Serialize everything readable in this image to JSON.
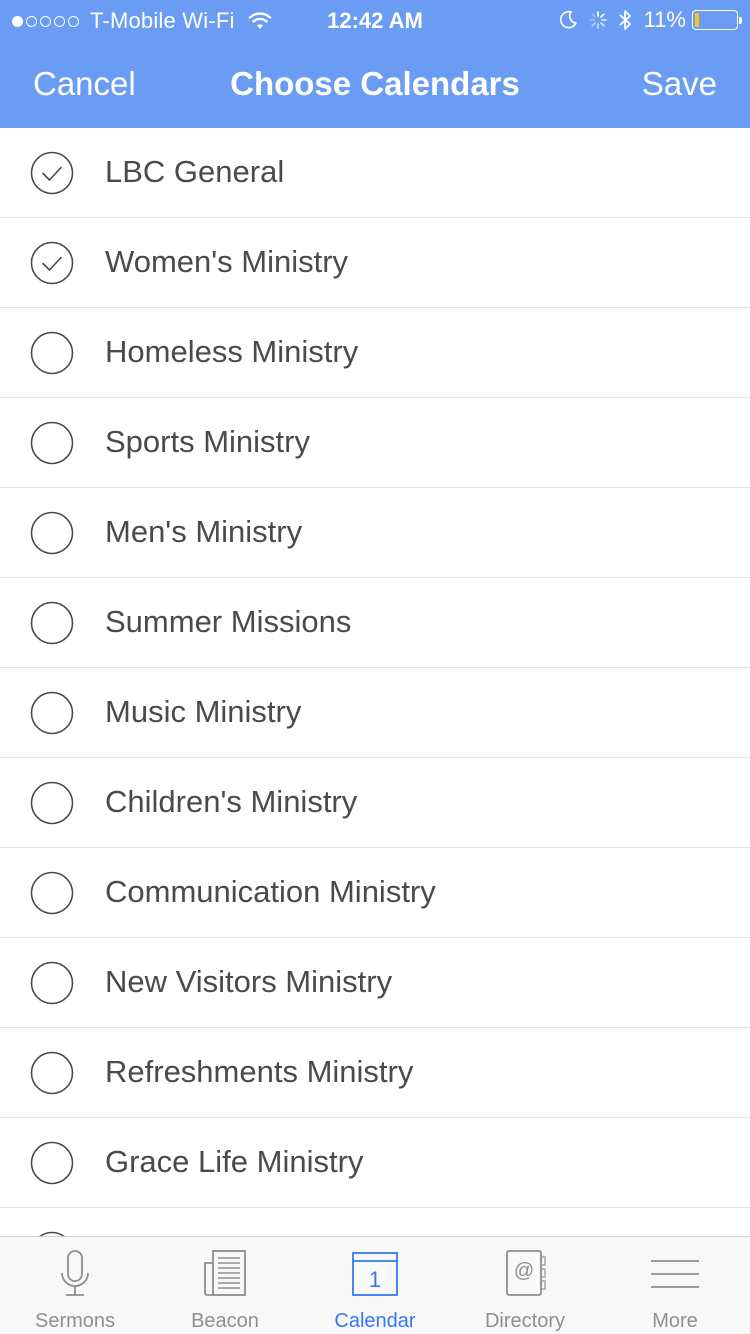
{
  "status_bar": {
    "carrier": "T-Mobile Wi-Fi",
    "signal_dots_filled": 1,
    "signal_dots_total": 5,
    "time": "12:42 AM",
    "battery_percent": "11%",
    "battery_level": 0.11
  },
  "nav": {
    "cancel_label": "Cancel",
    "title": "Choose Calendars",
    "save_label": "Save"
  },
  "calendars": [
    {
      "label": "LBC General",
      "checked": true
    },
    {
      "label": "Women's Ministry",
      "checked": true
    },
    {
      "label": "Homeless Ministry",
      "checked": false
    },
    {
      "label": "Sports Ministry",
      "checked": false
    },
    {
      "label": "Men's Ministry",
      "checked": false
    },
    {
      "label": "Summer Missions",
      "checked": false
    },
    {
      "label": "Music Ministry",
      "checked": false
    },
    {
      "label": "Children's Ministry",
      "checked": false
    },
    {
      "label": "Communication Ministry",
      "checked": false
    },
    {
      "label": "New Visitors Ministry",
      "checked": false
    },
    {
      "label": "Refreshments Ministry",
      "checked": false
    },
    {
      "label": "Grace Life Ministry",
      "checked": false
    },
    {
      "label": "",
      "checked": false
    }
  ],
  "tabs": [
    {
      "label": "Sermons",
      "icon": "microphone-icon",
      "active": false
    },
    {
      "label": "Beacon",
      "icon": "newspaper-icon",
      "active": false
    },
    {
      "label": "Calendar",
      "icon": "calendar-icon",
      "active": true,
      "icon_text": "1"
    },
    {
      "label": "Directory",
      "icon": "address-book-icon",
      "active": false
    },
    {
      "label": "More",
      "icon": "menu-icon",
      "active": false
    }
  ],
  "colors": {
    "header_bg": "#6b9cf3",
    "tab_active": "#3478f6",
    "tab_inactive": "#8e8e93",
    "battery_fill": "#f5c518"
  }
}
